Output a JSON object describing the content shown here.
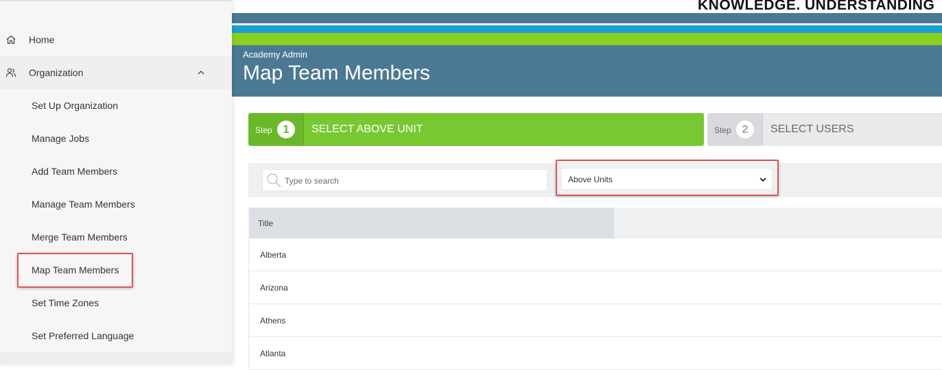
{
  "brand": {
    "tagline": "KNOWLEDGE. UNDERSTANDING"
  },
  "sidebar": {
    "home_label": "Home",
    "organization_label": "Organization",
    "items": [
      {
        "label": "Set Up Organization"
      },
      {
        "label": "Manage Jobs"
      },
      {
        "label": "Add Team Members"
      },
      {
        "label": "Manage Team Members"
      },
      {
        "label": "Merge Team Members"
      },
      {
        "label": "Map Team Members"
      },
      {
        "label": "Set Time Zones"
      },
      {
        "label": "Set Preferred Language"
      }
    ]
  },
  "header": {
    "subtitle": "Academy Admin",
    "title": "Map Team Members"
  },
  "steps": [
    {
      "word": "Step",
      "number": "1",
      "title": "SELECT ABOVE UNIT"
    },
    {
      "word": "Step",
      "number": "2",
      "title": "SELECT USERS"
    }
  ],
  "filters": {
    "search_placeholder": "Type to search",
    "select_value": "Above Units"
  },
  "table": {
    "column_title": "Title",
    "rows": [
      {
        "title": "Alberta"
      },
      {
        "title": "Arizona"
      },
      {
        "title": "Athens"
      },
      {
        "title": "Atlanta"
      }
    ]
  },
  "colors": {
    "header_slate": "#4b7994",
    "stripe_blue": "#1a9fd6",
    "stripe_green": "#8dcf1e",
    "step_active": "#78c832",
    "highlight_red": "#e05252"
  }
}
